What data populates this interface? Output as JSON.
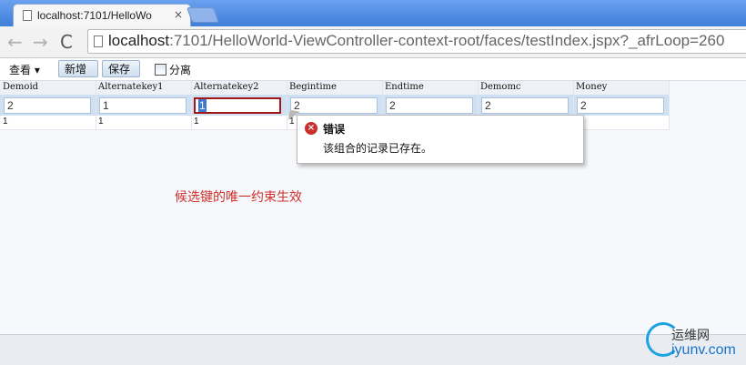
{
  "browser": {
    "tab_title": "localhost:7101/HelloWo",
    "tab_close": "×",
    "url_host": "localhost",
    "url_path": ":7101/HelloWorld-ViewController-context-root/faces/testIndex.jspx?_afrLoop=260",
    "back": "←",
    "forward": "→",
    "reload": "C"
  },
  "toolbar": {
    "view_label": "查看 ▾",
    "add_label": "新增",
    "save_label": "保存",
    "detach_label": "分离"
  },
  "table": {
    "columns": [
      "Demoid",
      "Alternatekey1",
      "Alternatekey2",
      "Begintime",
      "Endtime",
      "Demomc",
      "Money"
    ],
    "input_values": [
      "2",
      "1",
      "1",
      "2",
      "2",
      "2",
      "2"
    ],
    "row": [
      "1",
      "1",
      "1",
      "1",
      "",
      "",
      ""
    ]
  },
  "error_popup": {
    "icon": "×",
    "title": "错误",
    "message": "该组合的记录已存在。"
  },
  "annotation": "候选键的唯一约束生效",
  "watermark": {
    "top": "运维网",
    "bottom": "iyunv.com"
  },
  "colors": {
    "tab_strip": "#3e7fd8",
    "error": "#a01818",
    "annotation": "#d0312d"
  }
}
